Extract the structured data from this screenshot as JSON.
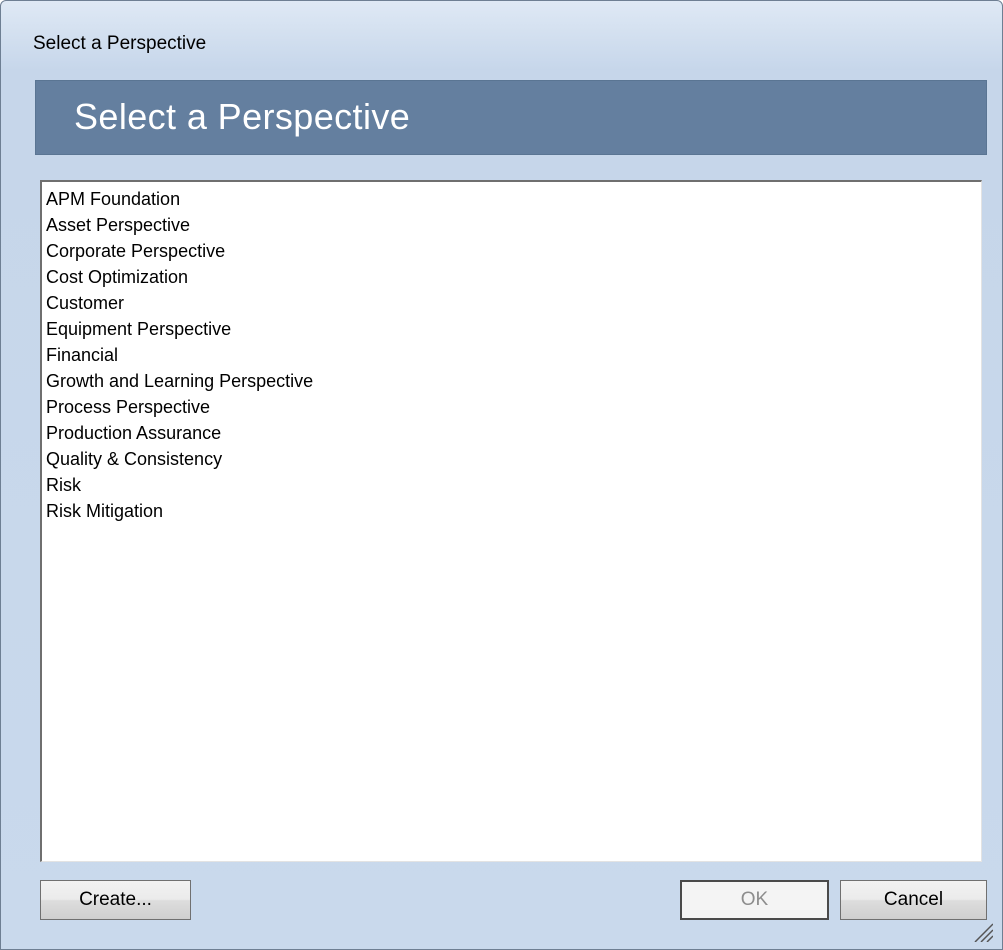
{
  "window": {
    "title": "Select a Perspective"
  },
  "header": {
    "title": "Select a Perspective",
    "color": "#647f9f"
  },
  "list": {
    "items": [
      "APM Foundation",
      "Asset Perspective",
      "Corporate Perspective",
      "Cost Optimization",
      "Customer",
      "Equipment Perspective",
      "Financial",
      "Growth and Learning Perspective",
      "Process Perspective",
      "Production Assurance",
      "Quality & Consistency",
      "Risk",
      "Risk Mitigation"
    ]
  },
  "buttons": {
    "create_label": "Create...",
    "ok_label": "OK",
    "ok_enabled": false,
    "cancel_label": "Cancel"
  },
  "icons": {
    "resize_grip": "resize-grip-icon"
  }
}
